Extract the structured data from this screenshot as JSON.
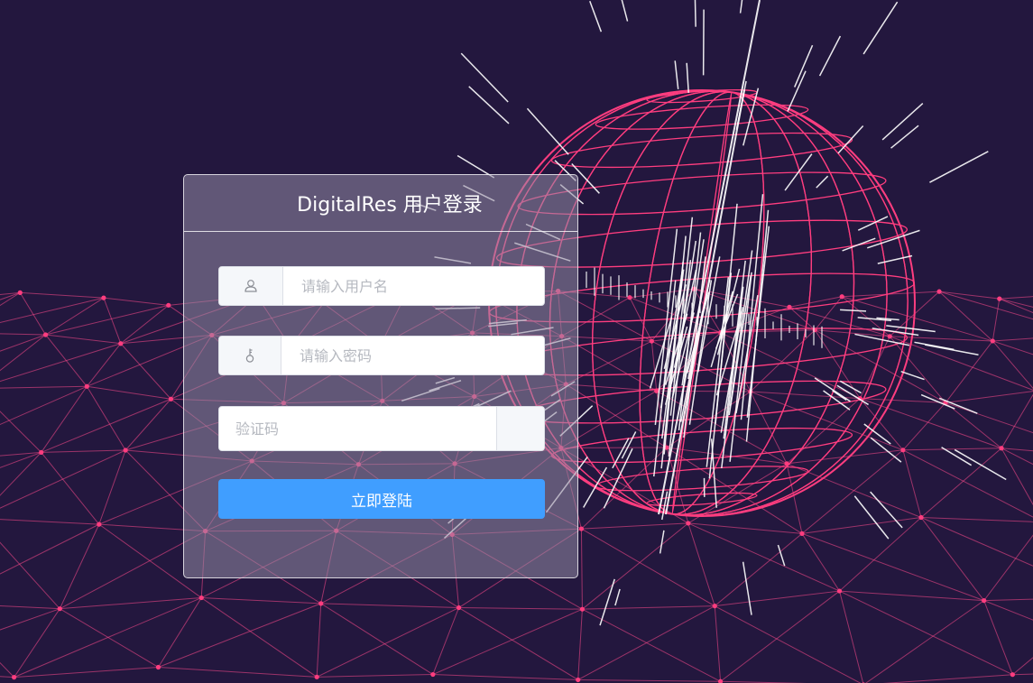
{
  "login": {
    "title": "DigitalRes 用户登录",
    "username_placeholder": "请输入用户名",
    "password_placeholder": "请输入密码",
    "captcha_placeholder": "验证码",
    "submit_label": "立即登陆"
  },
  "icons": {
    "username": "user-icon",
    "password": "key-icon"
  },
  "colors": {
    "background": "#23173e",
    "wireframe": "#ff3d7f",
    "button": "#409eff",
    "panel_border": "#ffffff"
  }
}
